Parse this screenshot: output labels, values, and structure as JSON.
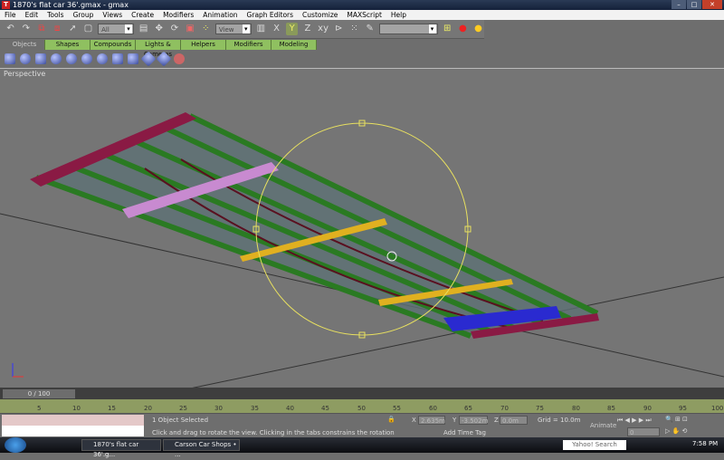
{
  "window": {
    "title": "1870's flat car 36'.gmax - gmax"
  },
  "menu": [
    "File",
    "Edit",
    "Tools",
    "Group",
    "Views",
    "Create",
    "Modifiers",
    "Animation",
    "Graph Editors",
    "Customize",
    "MAXScript",
    "Help"
  ],
  "toolbar": {
    "selection_filter": "All",
    "ref_coord": "View",
    "named_selection": ""
  },
  "tabs": [
    "Objects",
    "Shapes",
    "Compounds",
    "Lights & Cameras",
    "Helpers",
    "Modifiers",
    "Modeling"
  ],
  "viewport": {
    "label": "Perspective"
  },
  "timeslider": {
    "label": "0 / 100"
  },
  "timeline": {
    "ticks": [
      "5",
      "10",
      "15",
      "20",
      "25",
      "30",
      "35",
      "40",
      "45",
      "50",
      "55",
      "60",
      "65",
      "70",
      "75",
      "80",
      "85",
      "90",
      "95",
      "100"
    ]
  },
  "status": {
    "selection": "1 Object Selected",
    "prompt": "Click and drag to rotate the view.  Clicking in the tabs constrains the rotation",
    "x": "2.635m",
    "y": "-3.502m",
    "z": "0.0m",
    "grid": "Grid = 10.0m",
    "add_time_tag": "Add Time Tag",
    "animate": "Animate",
    "frame": "0"
  },
  "taskbar": {
    "tasks": [
      "1870's flat car 36'.g...",
      "Carson Car Shops • ..."
    ],
    "search": "Yahoo! Search",
    "clock": "7:58 PM"
  },
  "colors": {
    "end_beam": "#8a1a44",
    "bolster": "#c88ad0",
    "sill": "#2a7a22",
    "crossbar": "#e0b020",
    "selected": "#2a2ad0",
    "gizmo": "#e8e060"
  }
}
